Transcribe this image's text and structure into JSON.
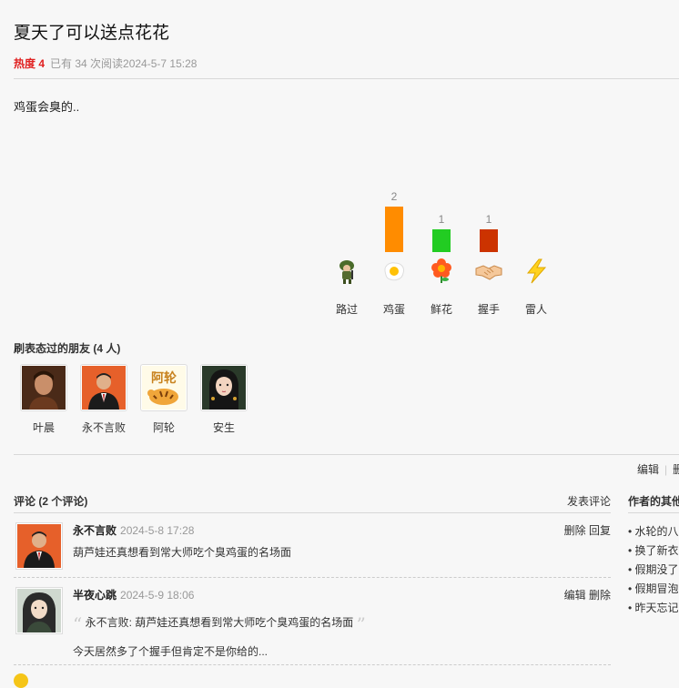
{
  "post": {
    "title": "夏天了可以送点花花",
    "hot_label": "热度 4",
    "meta": "已有 34 次阅读2024-5-7 15:28",
    "content": "鸡蛋会臭的.."
  },
  "chart_data": {
    "type": "bar",
    "categories": [
      "路过",
      "鸡蛋",
      "鲜花",
      "握手",
      "雷人"
    ],
    "values": [
      0,
      2,
      1,
      1,
      0
    ],
    "ylim": [
      0,
      2
    ],
    "colors": [
      "#888888",
      "#ff8c00",
      "#22cc22",
      "#cc3300",
      "#888888"
    ],
    "icons": [
      "soldier-icon",
      "fried-egg-icon",
      "flower-icon",
      "handshake-icon",
      "lightning-icon"
    ]
  },
  "friends": {
    "title": "刷表态过的朋友 (4 人)",
    "items": [
      {
        "name": "叶晨",
        "avatar": "man-portrait-avatar"
      },
      {
        "name": "永不言败",
        "avatar": "suited-man-avatar"
      },
      {
        "name": "阿轮",
        "avatar": "tiger-cartoon-avatar"
      },
      {
        "name": "安生",
        "avatar": "girl-portrait-avatar"
      }
    ]
  },
  "edit_bar": {
    "edit": "编辑",
    "delete": "删"
  },
  "comments": {
    "title": "评论 (2 个评论)",
    "post_label": "发表评论",
    "items": [
      {
        "author": "永不言败",
        "time": "2024-5-8 17:28",
        "actions": [
          "删除",
          "回复"
        ],
        "text": "葫芦娃还真想看到常大师吃个臭鸡蛋的名场面"
      },
      {
        "author": "半夜心跳",
        "time": "2024-5-9 18:06",
        "actions": [
          "编辑",
          "删除"
        ],
        "quote": "永不言败: 葫芦娃还真想看到常大师吃个臭鸡蛋的名场面",
        "text": "今天居然多了个握手但肯定不是你给的..."
      }
    ]
  },
  "sidebar": {
    "title": "作者的其他",
    "items": [
      "• 水轮的八",
      "• 换了新衣",
      "• 假期没了",
      "• 假期冒泡",
      "• 昨天忘记"
    ]
  }
}
